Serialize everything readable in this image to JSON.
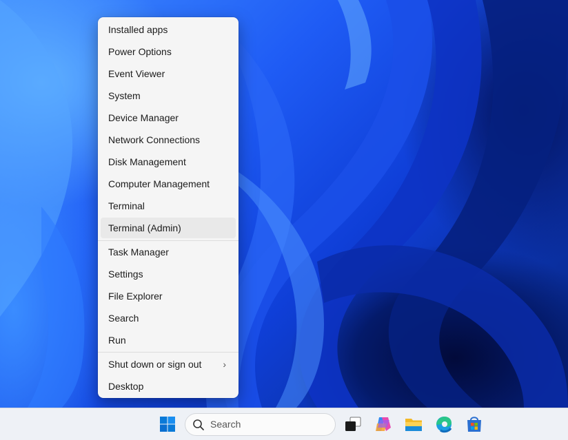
{
  "menu": {
    "items": [
      {
        "label": "Installed apps"
      },
      {
        "label": "Power Options"
      },
      {
        "label": "Event Viewer"
      },
      {
        "label": "System"
      },
      {
        "label": "Device Manager"
      },
      {
        "label": "Network Connections"
      },
      {
        "label": "Disk Management"
      },
      {
        "label": "Computer Management"
      },
      {
        "label": "Terminal"
      },
      {
        "label": "Terminal (Admin)",
        "hovered": true
      },
      {
        "label": "Task Manager"
      },
      {
        "label": "Settings"
      },
      {
        "label": "File Explorer"
      },
      {
        "label": "Search"
      },
      {
        "label": "Run"
      },
      {
        "label": "Shut down or sign out",
        "submenu": true,
        "submenu_glyph": "›"
      },
      {
        "label": "Desktop"
      }
    ]
  },
  "taskbar": {
    "search_placeholder": "Search",
    "icons": [
      "windows-start-icon",
      "search-icon",
      "task-view-icon",
      "copilot-icon",
      "file-explorer-icon",
      "edge-icon",
      "microsoft-store-icon"
    ]
  },
  "colors": {
    "accent": "#0067c0",
    "menu_background": "#f5f5f5",
    "taskbar_background": "#eef1f6"
  }
}
